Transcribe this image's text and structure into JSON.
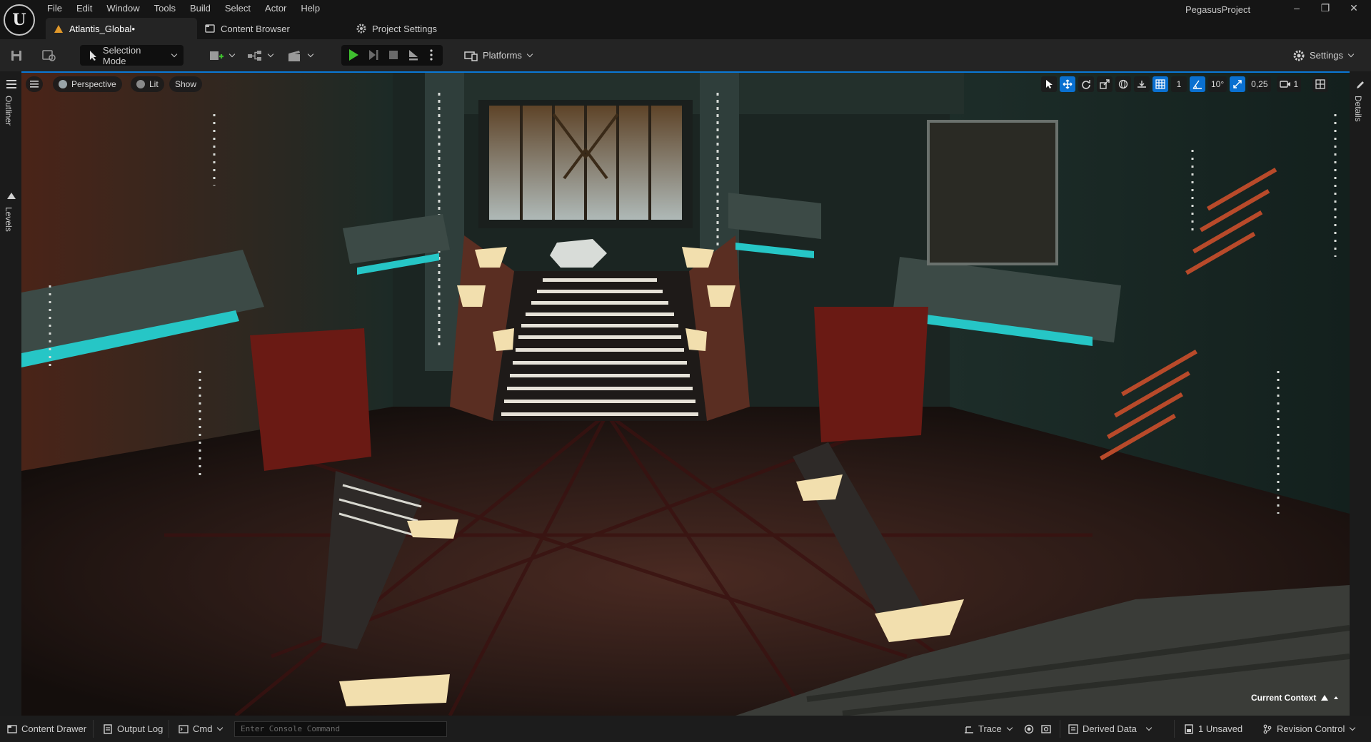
{
  "app": {
    "menu": [
      "File",
      "Edit",
      "Window",
      "Tools",
      "Build",
      "Select",
      "Actor",
      "Help"
    ],
    "project_name": "PegasusProject",
    "logo_text": "U"
  },
  "tabs": [
    {
      "label": "Atlantis_Global•",
      "icon": "level-icon"
    },
    {
      "label": "Content Browser",
      "icon": "content-browser-icon"
    },
    {
      "label": "Project Settings",
      "icon": "settings-gear-icon"
    }
  ],
  "window_controls": {
    "minimize": "–",
    "restore": "❐",
    "close": "✕"
  },
  "toolbar": {
    "selection_mode": "Selection Mode",
    "platforms": "Platforms",
    "settings": "Settings",
    "play_color": "#3fbf2f"
  },
  "side_tabs": {
    "outliner": "Outliner",
    "levels": "Levels",
    "details": "Details"
  },
  "viewport": {
    "perspective": "Perspective",
    "lit": "Lit",
    "show": "Show",
    "grid_snap": "1",
    "rotation_snap": "10°",
    "scale_snap": "0,25",
    "camera_speed": "1",
    "current_context": "Current Context",
    "accent_color": "#0a78d6"
  },
  "statusbar": {
    "content_drawer": "Content Drawer",
    "output_log": "Output Log",
    "cmd": "Cmd",
    "console_placeholder": "Enter Console Command",
    "trace": "Trace",
    "derived_data": "Derived Data",
    "unsaved": "1 Unsaved",
    "revision_control": "Revision Control"
  }
}
